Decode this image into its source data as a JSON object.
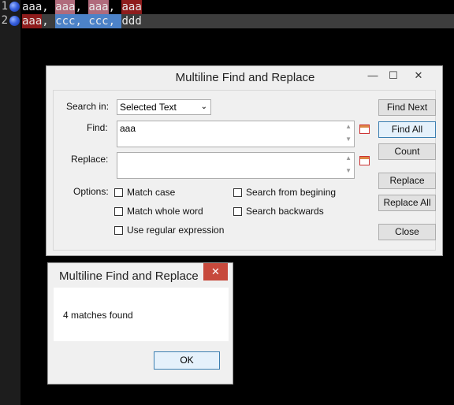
{
  "editor": {
    "line_numbers": [
      "1",
      "2"
    ],
    "line1": [
      "aaa",
      ", ",
      "aaa",
      ", ",
      "aaa",
      ", ",
      "aaa"
    ],
    "line2": [
      "aaa",
      ", ",
      "ccc",
      ", ",
      "ccc",
      ", ",
      "ddd"
    ]
  },
  "main_dialog": {
    "title": "Multiline Find and Replace",
    "minimize": "—",
    "maximize": "☐",
    "close": "✕",
    "search_in_label": "Search in:",
    "search_in_value": "Selected Text",
    "find_label": "Find:",
    "find_value": "aaa",
    "replace_label": "Replace:",
    "replace_value": "",
    "options_label": "Options:",
    "options": {
      "match_case": "Match case",
      "match_whole_word": "Match whole word",
      "use_regex": "Use regular expression",
      "search_from_beginning": "Search from begining",
      "search_backwards": "Search backwards"
    },
    "buttons": {
      "find_next": "Find Next",
      "find_all": "Find All",
      "count": "Count",
      "replace": "Replace",
      "replace_all": "Replace All",
      "close": "Close"
    }
  },
  "message_dialog": {
    "title": "Multiline Find and Replace",
    "close": "✕",
    "text": "4 matches found",
    "ok": "OK"
  }
}
